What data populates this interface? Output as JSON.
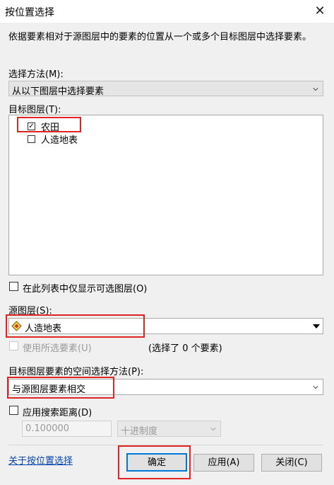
{
  "window": {
    "title": "按位置选择",
    "close_glyph": "✕"
  },
  "description": "依据要素相对于源图层中的要素的位置从一个或多个目标图层中选择要素。",
  "selection_method": {
    "label": "选择方法(M):",
    "value": "从以下图层中选择要素"
  },
  "target_layers": {
    "label": "目标图层(T):",
    "items": [
      {
        "name": "农田",
        "checked": true,
        "mark": "✓"
      },
      {
        "name": "人造地表",
        "checked": false,
        "mark": ""
      }
    ]
  },
  "only_selectable": {
    "label": "在此列表中仅显示可选图层(O)",
    "checked": false
  },
  "source_layer": {
    "label": "源图层(S):",
    "value": "人造地表",
    "use_selected_label": "使用所选要素(U)",
    "selected_count_text": "(选择了 0 个要素)"
  },
  "spatial_method": {
    "label": "目标图层要素的空间选择方法(P):",
    "value": "与源图层要素相交"
  },
  "search_distance": {
    "label": "应用搜索距离(D)",
    "checked": false,
    "value": "0.100000",
    "unit": "十进制度"
  },
  "footer": {
    "help_link": "关于按位置选择",
    "ok_label": "确定",
    "apply_label": "应用(A)",
    "close_label": "关闭(C)"
  },
  "colors": {
    "highlight_red": "#e02424",
    "link_blue": "#0645ad",
    "dialog_bg": "#f0f0f0"
  },
  "icons": {
    "layer_icon": "layer-diamond-icon",
    "chevron": "chevron-down-icon",
    "dropdown_arrow": "dropdown-arrow-icon"
  }
}
